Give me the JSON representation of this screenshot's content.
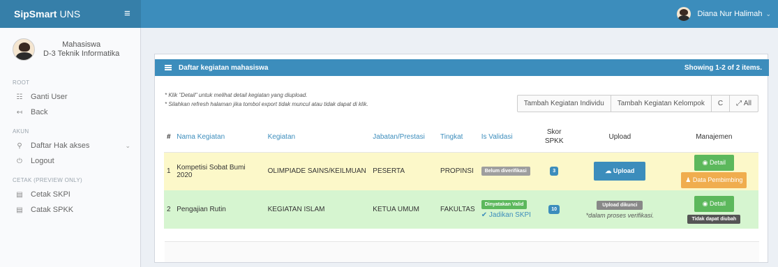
{
  "app": {
    "brand_bold": "SipSmart",
    "brand_light": "UNS",
    "menu_icon": "hamburger-icon"
  },
  "user": {
    "name": "Diana Nur Halimah"
  },
  "profile": {
    "role": "Mahasiswa",
    "program": "D-3 Teknik Informatika"
  },
  "sidebar": {
    "sections": [
      {
        "title": "ROOT",
        "items": [
          {
            "label": "Ganti User",
            "icon": "users-icon"
          },
          {
            "label": "Back",
            "icon": "back-icon"
          }
        ]
      },
      {
        "title": "AKUN",
        "items": [
          {
            "label": "Daftar Hak akses",
            "icon": "key-icon"
          },
          {
            "label": "Logout",
            "icon": "power-icon"
          }
        ]
      },
      {
        "title": "CETAK (PREVIEW ONLY)",
        "items": [
          {
            "label": "Cetak SKPI",
            "icon": "file-icon"
          },
          {
            "label": "Catak SPKK",
            "icon": "file-icon"
          }
        ]
      }
    ]
  },
  "panel": {
    "title": "Daftar kegiatan mahasiswa",
    "showing": "Showing 1-2 of 2 items.",
    "note1": "* Klik \"Detail\" untuk melihat detail kegiatan yang diupload.",
    "note2": "* Silahkan refresh halaman jika tombol export tidak muncul atau tidak dapat di klik.",
    "toolbar": {
      "individu": "Tambah Kegiatan Individu",
      "kelompok": "Tambah Kegiatan Kelompok",
      "refresh": "C",
      "all": "All"
    }
  },
  "table": {
    "headers": [
      "#",
      "Nama Kegiatan",
      "Kegiatan",
      "Jabatan/Prestasi",
      "Tingkat",
      "Is Validasi",
      "Skor SPKK",
      "Upload",
      "Manajemen"
    ],
    "rows": [
      {
        "no": "1",
        "nama": "Kompetisi Sobat Bumi 2020",
        "kegiatan": "OLIMPIADE SAINS/KEILMUAN",
        "jabatan": "PESERTA",
        "tingkat": "PROPINSI",
        "validasi": "Belum diverifikasi",
        "skor": "3",
        "upload": "Upload",
        "detail": "Detail",
        "pembimbing": "Data Pembimbing"
      },
      {
        "no": "2",
        "nama": "Pengajian Rutin",
        "kegiatan": "KEGIATAN ISLAM",
        "jabatan": "KETUA UMUM",
        "tingkat": "FAKULTAS",
        "validasi": "Dinyatakan Valid",
        "jadikan": "Jadikan SKPI",
        "skor": "10",
        "upload_locked": "Upload dikunci",
        "verif_note": "*dalam proses verifikasi.",
        "detail": "Detail",
        "tidak_diubah": "Tidak dapat diubah"
      }
    ]
  }
}
